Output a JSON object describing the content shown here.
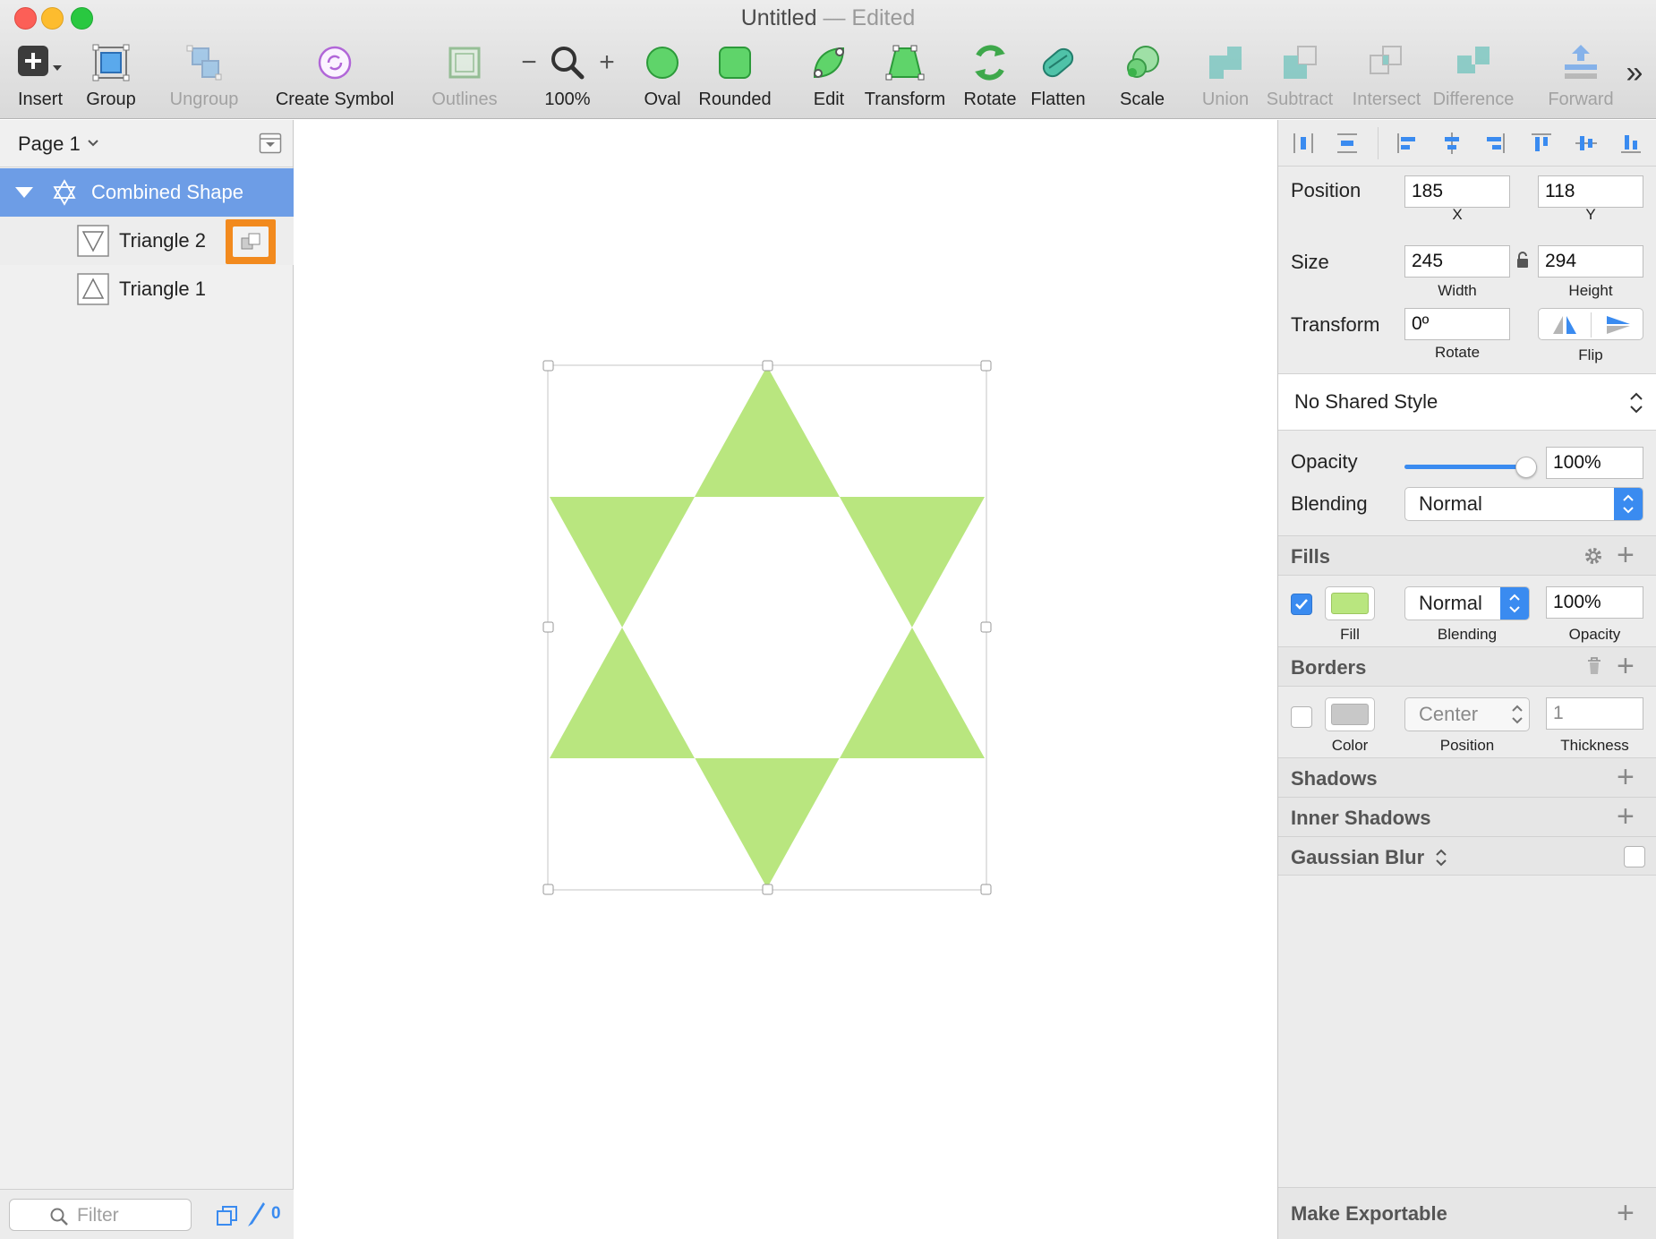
{
  "window": {
    "title": "Untitled",
    "title_sep": "—",
    "status": "Edited"
  },
  "toolbar": {
    "insert": "Insert",
    "group": "Group",
    "ungroup": "Ungroup",
    "create_symbol": "Create Symbol",
    "outlines": "Outlines",
    "zoom_minus": "−",
    "zoom_plus": "+",
    "zoom": "100%",
    "oval": "Oval",
    "rounded": "Rounded",
    "edit": "Edit",
    "transform": "Transform",
    "rotate": "Rotate",
    "flatten": "Flatten",
    "scale": "Scale",
    "union": "Union",
    "subtract": "Subtract",
    "intersect": "Intersect",
    "difference": "Difference",
    "forward": "Forward",
    "overflow": "»"
  },
  "sidebar": {
    "page": "Page 1",
    "layers": [
      {
        "name": "Combined Shape"
      },
      {
        "name": "Triangle 2"
      },
      {
        "name": "Triangle 1"
      }
    ],
    "filter_placeholder": "Filter",
    "slice_count": "0"
  },
  "inspector": {
    "position_label": "Position",
    "x": "185",
    "x_label": "X",
    "y": "118",
    "y_label": "Y",
    "size_label": "Size",
    "width": "245",
    "width_label": "Width",
    "height": "294",
    "height_label": "Height",
    "transform_label": "Transform",
    "rotate": "0º",
    "rotate_label": "Rotate",
    "flip_label": "Flip",
    "shared_style": "No Shared Style",
    "opacity_label": "Opacity",
    "opacity": "100%",
    "opacity_level": 1.0,
    "blending_label": "Blending",
    "blending": "Normal",
    "fills": {
      "title": "Fills",
      "fill_label": "Fill",
      "blending": "Normal",
      "blending_label": "Blending",
      "opacity": "100%",
      "opacity_label": "Opacity",
      "color": "#b9e67f",
      "enabled": true
    },
    "borders": {
      "title": "Borders",
      "color_label": "Color",
      "position": "Center",
      "position_label": "Position",
      "thickness": "1",
      "thickness_label": "Thickness",
      "color": "#c8c8c8",
      "enabled": false
    },
    "shadows": "Shadows",
    "inner_shadows": "Inner Shadows",
    "gaussian_blur": "Gaussian Blur",
    "make_exportable": "Make Exportable"
  },
  "colors": {
    "selection": "#6d9de6",
    "shape_fill": "#b9e67f",
    "accent": "#3a8bf0",
    "highlight": "#f28a1e"
  }
}
